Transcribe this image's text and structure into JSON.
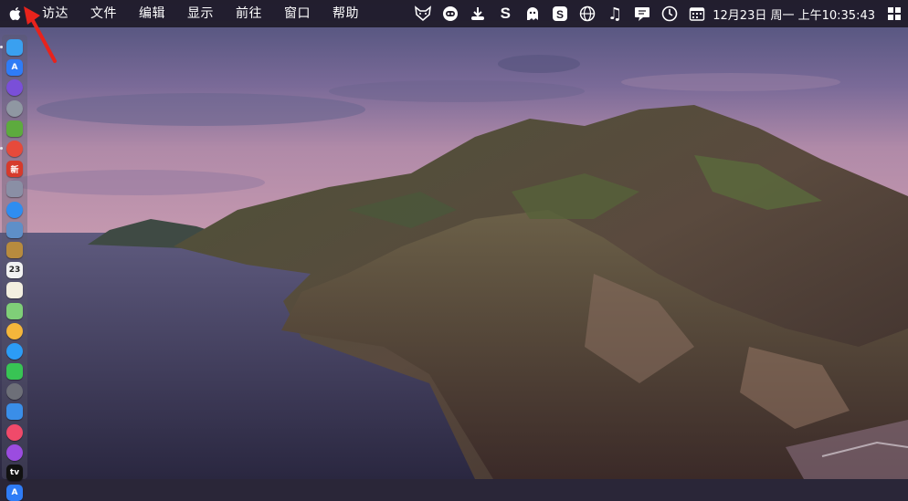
{
  "menubar": {
    "apple_icon": "apple-icon",
    "menus": [
      "访达",
      "文件",
      "编辑",
      "显示",
      "前往",
      "窗口",
      "帮助"
    ],
    "status_icons": [
      "fox-icon",
      "robot-face-icon",
      "download-tray-icon",
      "s-app-icon",
      "ghost-icon",
      "s-rounded-app-icon",
      "globe-icon",
      "music-note-icon",
      "chat-display-icon",
      "time-machine-icon",
      "calendar-icon"
    ],
    "clock": "12月23日 周一 上午10:35:43",
    "right_icon": "grid-icon"
  },
  "dock": {
    "items": [
      {
        "name": "finder",
        "color": "#3aa0f0",
        "label": "",
        "running": true
      },
      {
        "name": "app-store",
        "color": "#2f7cf6",
        "label": "A",
        "running": false
      },
      {
        "name": "siri",
        "color": "#7a4fd8",
        "label": "",
        "running": false
      },
      {
        "name": "launchpad",
        "color": "#8f97a2",
        "label": "",
        "running": false
      },
      {
        "name": "android-studio",
        "color": "#5dab3e",
        "label": "",
        "running": false
      },
      {
        "name": "chrome",
        "color": "#e64a3b",
        "label": "",
        "running": true
      },
      {
        "name": "text-app",
        "color": "#d63a2c",
        "label": "新",
        "running": false
      },
      {
        "name": "disk-utility",
        "color": "#8a8fa5",
        "label": "",
        "running": false
      },
      {
        "name": "safari",
        "color": "#2f8df0",
        "label": "",
        "running": false
      },
      {
        "name": "preview",
        "color": "#5e8fc8",
        "label": "",
        "running": false
      },
      {
        "name": "notebook",
        "color": "#b78b3e",
        "label": "",
        "running": false
      },
      {
        "name": "calendar",
        "color": "#f2f2f2",
        "label": "23",
        "running": false
      },
      {
        "name": "notes",
        "color": "#f3efe0",
        "label": "",
        "running": false
      },
      {
        "name": "maps",
        "color": "#7fcf78",
        "label": "",
        "running": false
      },
      {
        "name": "photos",
        "color": "#f4b63b",
        "label": "",
        "running": false
      },
      {
        "name": "messages",
        "color": "#2c9cf6",
        "label": "",
        "running": false
      },
      {
        "name": "facetime",
        "color": "#38c454",
        "label": "",
        "running": false
      },
      {
        "name": "system-preferences",
        "color": "#6d6f78",
        "label": "",
        "running": false
      },
      {
        "name": "keynote",
        "color": "#3a8ee8",
        "label": "",
        "running": false
      },
      {
        "name": "music",
        "color": "#f04a6a",
        "label": "",
        "running": false
      },
      {
        "name": "podcasts",
        "color": "#9b4ce0",
        "label": "",
        "running": false
      },
      {
        "name": "apple-tv",
        "color": "#111111",
        "label": "tv",
        "running": false
      },
      {
        "name": "app-store-2",
        "color": "#2f7cf6",
        "label": "A",
        "running": false
      }
    ]
  },
  "colors": {
    "menubar_bg": "#1e1a28",
    "arrow": "#e8231c"
  }
}
